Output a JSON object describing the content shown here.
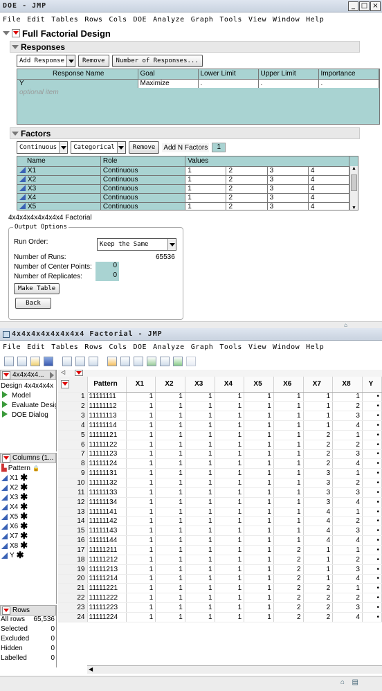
{
  "win1": {
    "title": "DOE - JMP",
    "menu": [
      "File",
      "Edit",
      "Tables",
      "Rows",
      "Cols",
      "DOE",
      "Analyze",
      "Graph",
      "Tools",
      "View",
      "Window",
      "Help"
    ],
    "heading": "Full Factorial Design",
    "responses": {
      "title": "Responses",
      "add_btn": "Add Response",
      "remove_btn": "Remove",
      "num_btn": "Number of Responses...",
      "cols": [
        "Response Name",
        "Goal",
        "Lower Limit",
        "Upper Limit",
        "Importance"
      ],
      "row": {
        "name": "Y",
        "goal": "Maximize",
        "lower": ".",
        "upper": ".",
        "importance": "."
      },
      "optional": "optional item"
    },
    "factors": {
      "title": "Factors",
      "cont_btn": "Continuous",
      "cat_btn": "Categorical",
      "remove_btn": "Remove",
      "addn_label": "Add N Factors",
      "addn_value": "1",
      "cols": [
        "Name",
        "Role",
        "Values"
      ],
      "rows": [
        {
          "name": "X1",
          "role": "Continuous",
          "v": [
            "1",
            "2",
            "3",
            "4"
          ]
        },
        {
          "name": "X2",
          "role": "Continuous",
          "v": [
            "1",
            "2",
            "3",
            "4"
          ]
        },
        {
          "name": "X3",
          "role": "Continuous",
          "v": [
            "1",
            "2",
            "3",
            "4"
          ]
        },
        {
          "name": "X4",
          "role": "Continuous",
          "v": [
            "1",
            "2",
            "3",
            "4"
          ]
        },
        {
          "name": "X5",
          "role": "Continuous",
          "v": [
            "1",
            "2",
            "3",
            "4"
          ]
        }
      ]
    },
    "factorial_label": "4x4x4x4x4x4x4x4 Factorial",
    "output": {
      "title": "Output Options",
      "run_order_label": "Run Order:",
      "run_order_value": "Keep the Same",
      "runs_label": "Number of Runs:",
      "runs_value": "65536",
      "center_label": "Number of Center Points:",
      "center_value": "0",
      "rep_label": "Number of Replicates:",
      "rep_value": "0",
      "make_btn": "Make Table",
      "back_btn": "Back"
    }
  },
  "win2": {
    "title": "4x4x4x4x4x4x4x4 Factorial - JMP",
    "menu": [
      "File",
      "Edit",
      "Tables",
      "Rows",
      "Cols",
      "DOE",
      "Analyze",
      "Graph",
      "Tools",
      "View",
      "Window",
      "Help"
    ],
    "design": {
      "label": "4x4x4x4...",
      "design_label": "Design",
      "design_value": "4x4x4x4x",
      "items": [
        "Model",
        "Evaluate Desig",
        "DOE Dialog"
      ]
    },
    "columns": {
      "label": "Columns (1...",
      "items": [
        "Pattern",
        "X1",
        "X2",
        "X3",
        "X4",
        "X5",
        "X6",
        "X7",
        "X8",
        "Y"
      ]
    },
    "rows_panel": {
      "label": "Rows",
      "items": [
        {
          "k": "All rows",
          "v": "65,536"
        },
        {
          "k": "Selected",
          "v": "0"
        },
        {
          "k": "Excluded",
          "v": "0"
        },
        {
          "k": "Hidden",
          "v": "0"
        },
        {
          "k": "Labelled",
          "v": "0"
        }
      ]
    },
    "grid": {
      "headers": [
        "Pattern",
        "X1",
        "X2",
        "X3",
        "X4",
        "X5",
        "X6",
        "X7",
        "X8",
        "Y"
      ],
      "rows": [
        [
          "1",
          "11111111",
          "1",
          "1",
          "1",
          "1",
          "1",
          "1",
          "1",
          "1",
          "•"
        ],
        [
          "2",
          "11111112",
          "1",
          "1",
          "1",
          "1",
          "1",
          "1",
          "1",
          "2",
          "•"
        ],
        [
          "3",
          "11111113",
          "1",
          "1",
          "1",
          "1",
          "1",
          "1",
          "1",
          "3",
          "•"
        ],
        [
          "4",
          "11111114",
          "1",
          "1",
          "1",
          "1",
          "1",
          "1",
          "1",
          "4",
          "•"
        ],
        [
          "5",
          "11111121",
          "1",
          "1",
          "1",
          "1",
          "1",
          "1",
          "2",
          "1",
          "•"
        ],
        [
          "6",
          "11111122",
          "1",
          "1",
          "1",
          "1",
          "1",
          "1",
          "2",
          "2",
          "•"
        ],
        [
          "7",
          "11111123",
          "1",
          "1",
          "1",
          "1",
          "1",
          "1",
          "2",
          "3",
          "•"
        ],
        [
          "8",
          "11111124",
          "1",
          "1",
          "1",
          "1",
          "1",
          "1",
          "2",
          "4",
          "•"
        ],
        [
          "9",
          "11111131",
          "1",
          "1",
          "1",
          "1",
          "1",
          "1",
          "3",
          "1",
          "•"
        ],
        [
          "10",
          "11111132",
          "1",
          "1",
          "1",
          "1",
          "1",
          "1",
          "3",
          "2",
          "•"
        ],
        [
          "11",
          "11111133",
          "1",
          "1",
          "1",
          "1",
          "1",
          "1",
          "3",
          "3",
          "•"
        ],
        [
          "12",
          "11111134",
          "1",
          "1",
          "1",
          "1",
          "1",
          "1",
          "3",
          "4",
          "•"
        ],
        [
          "13",
          "11111141",
          "1",
          "1",
          "1",
          "1",
          "1",
          "1",
          "4",
          "1",
          "•"
        ],
        [
          "14",
          "11111142",
          "1",
          "1",
          "1",
          "1",
          "1",
          "1",
          "4",
          "2",
          "•"
        ],
        [
          "15",
          "11111143",
          "1",
          "1",
          "1",
          "1",
          "1",
          "1",
          "4",
          "3",
          "•"
        ],
        [
          "16",
          "11111144",
          "1",
          "1",
          "1",
          "1",
          "1",
          "1",
          "4",
          "4",
          "•"
        ],
        [
          "17",
          "11111211",
          "1",
          "1",
          "1",
          "1",
          "1",
          "2",
          "1",
          "1",
          "•"
        ],
        [
          "18",
          "11111212",
          "1",
          "1",
          "1",
          "1",
          "1",
          "2",
          "1",
          "2",
          "•"
        ],
        [
          "19",
          "11111213",
          "1",
          "1",
          "1",
          "1",
          "1",
          "2",
          "1",
          "3",
          "•"
        ],
        [
          "20",
          "11111214",
          "1",
          "1",
          "1",
          "1",
          "1",
          "2",
          "1",
          "4",
          "•"
        ],
        [
          "21",
          "11111221",
          "1",
          "1",
          "1",
          "1",
          "1",
          "2",
          "2",
          "1",
          "•"
        ],
        [
          "22",
          "11111222",
          "1",
          "1",
          "1",
          "1",
          "1",
          "2",
          "2",
          "2",
          "•"
        ],
        [
          "23",
          "11111223",
          "1",
          "1",
          "1",
          "1",
          "1",
          "2",
          "2",
          "3",
          "•"
        ],
        [
          "24",
          "11111224",
          "1",
          "1",
          "1",
          "1",
          "1",
          "2",
          "2",
          "4",
          "•"
        ]
      ]
    }
  }
}
